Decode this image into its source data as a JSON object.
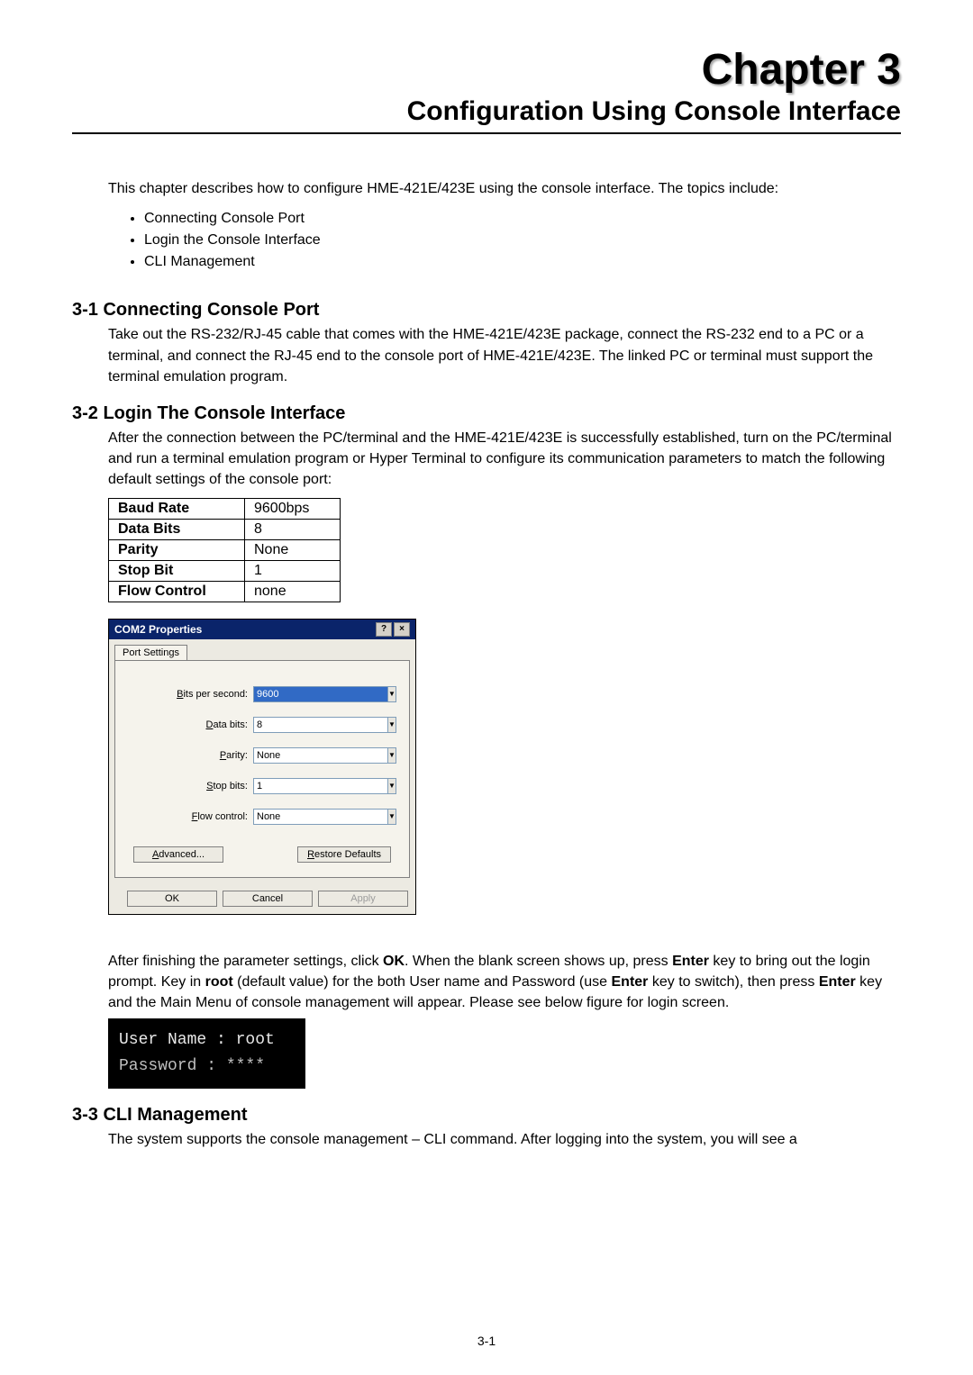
{
  "chapter_title": "Chapter 3",
  "subtitle": "Configuration Using Console Interface",
  "intro": "This chapter describes how to configure HME-421E/423E using the console interface. The topics include:",
  "topics": [
    "Connecting Console Port",
    "Login the Console Interface",
    "CLI Management"
  ],
  "sections": {
    "s31": {
      "heading": "3-1 Connecting Console Port",
      "body": "Take out the RS-232/RJ-45 cable that comes with the HME-421E/423E package, connect the RS-232 end to a PC or a terminal, and connect the RJ-45 end to the console port of HME-421E/423E. The linked PC or terminal must support the terminal emulation program."
    },
    "s32": {
      "heading": "3-2 Login The Console Interface",
      "body1": "After the connection between the PC/terminal and the HME-421E/423E is successfully established, turn on the PC/terminal and run a terminal emulation program or Hyper Terminal to configure its communication parameters to match the following default settings of the console port:",
      "table": [
        {
          "label": "Baud Rate",
          "value": "9600bps"
        },
        {
          "label": "Data Bits",
          "value": "8"
        },
        {
          "label": "Parity",
          "value": "None"
        },
        {
          "label": "Stop Bit",
          "value": "1"
        },
        {
          "label": "Flow Control",
          "value": "none"
        }
      ],
      "body2_pre": "After finishing the parameter settings, click ",
      "body2_ok": "OK",
      "body2_mid1": ". When the blank screen shows up, press ",
      "body2_enter": "Enter",
      "body2_mid2": " key to bring out the login prompt. Key in ",
      "body2_root": "root",
      "body2_mid3": " (default value) for the both User name and Password (use ",
      "body2_mid4": " key to switch), then press ",
      "body2_tail": " key and the Main Menu of console management will appear. Please see below figure for login screen."
    },
    "s33": {
      "heading": "3-3 CLI Management",
      "body": "The system supports the console management – CLI command. After logging into the system, you will see a"
    }
  },
  "dialog": {
    "title": "COM2 Properties",
    "help_btn": "?",
    "close_btn": "×",
    "tab": "Port Settings",
    "fields": {
      "bps_label_u": "B",
      "bps_label_rest": "its per second:",
      "bps_value": "9600",
      "databits_label_u": "D",
      "databits_label_rest": "ata bits:",
      "databits_value": "8",
      "parity_label_u": "P",
      "parity_label_rest": "arity:",
      "parity_value": "None",
      "stopbits_label_u": "S",
      "stopbits_label_rest": "top bits:",
      "stopbits_value": "1",
      "flow_label_u": "F",
      "flow_label_rest": "low control:",
      "flow_value": "None"
    },
    "advanced_u": "A",
    "advanced_rest": "dvanced...",
    "restore_u": "R",
    "restore_rest": "estore Defaults",
    "ok": "OK",
    "cancel": "Cancel",
    "apply": "Apply"
  },
  "login": {
    "line1": "User Name : root",
    "line2": "Password  : ****"
  },
  "page_number": "3-1"
}
